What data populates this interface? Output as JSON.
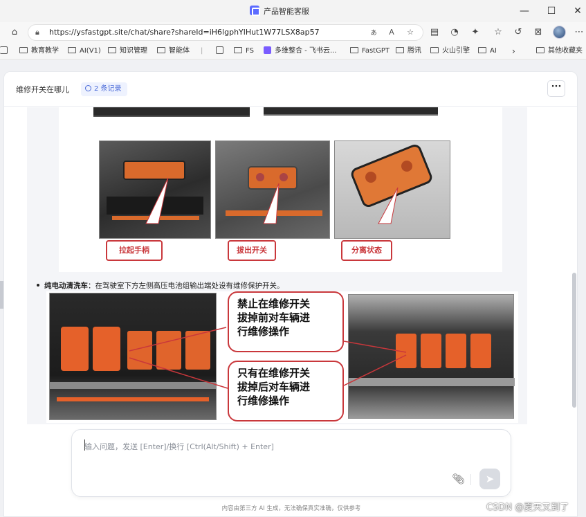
{
  "window": {
    "title": "产品智能客服"
  },
  "browser": {
    "url": "https://ysfastgpt.site/chat/share?shareId=iH6lgphYlHut1W77LSX8ap57"
  },
  "bookmarks": [
    {
      "label": "教育教学",
      "icon": "folder-icon"
    },
    {
      "label": "AI(V1)",
      "icon": "folder-icon"
    },
    {
      "label": "知识管理",
      "icon": "folder-icon"
    },
    {
      "label": "智能体",
      "icon": "folder-icon"
    },
    {
      "label": "FS",
      "icon": "folder-icon"
    },
    {
      "label": "多维整合 - 飞书云...",
      "icon": "feishu-icon"
    },
    {
      "label": "FastGPT",
      "icon": "folder-icon"
    },
    {
      "label": "腾讯",
      "icon": "folder-icon"
    },
    {
      "label": "火山引擎",
      "icon": "folder-icon"
    },
    {
      "label": "AI",
      "icon": "folder-icon"
    },
    {
      "label": "其他收藏夹",
      "icon": "folder-icon"
    }
  ],
  "chat": {
    "title": "维修开关在哪儿",
    "records": "2 条记录",
    "image1_labels": [
      "拉起手柄",
      "拔出开关",
      "分离状态"
    ],
    "bullet_bold": "纯电动清洗车",
    "bullet_text": "：在驾驶室下方左侧高压电池组输出端处设有维修保护开关。",
    "image2_callouts": [
      [
        "禁止在维修开关",
        "拔掉前对车辆进",
        "行维修操作"
      ],
      [
        "只有在维修开关",
        "拔掉后对车辆进",
        "行维修操作"
      ]
    ],
    "input_placeholder": "输入问题，发送 [Enter]/换行 [Ctrl(Alt/Shift) + Enter]",
    "footnote": "内容由第三方 AI 生成，无法确保真实准确，仅供参考"
  },
  "watermark": "CSDN @夏天又到了",
  "colors": {
    "accent": "#4b6bd8",
    "callout": "#c9373b"
  }
}
